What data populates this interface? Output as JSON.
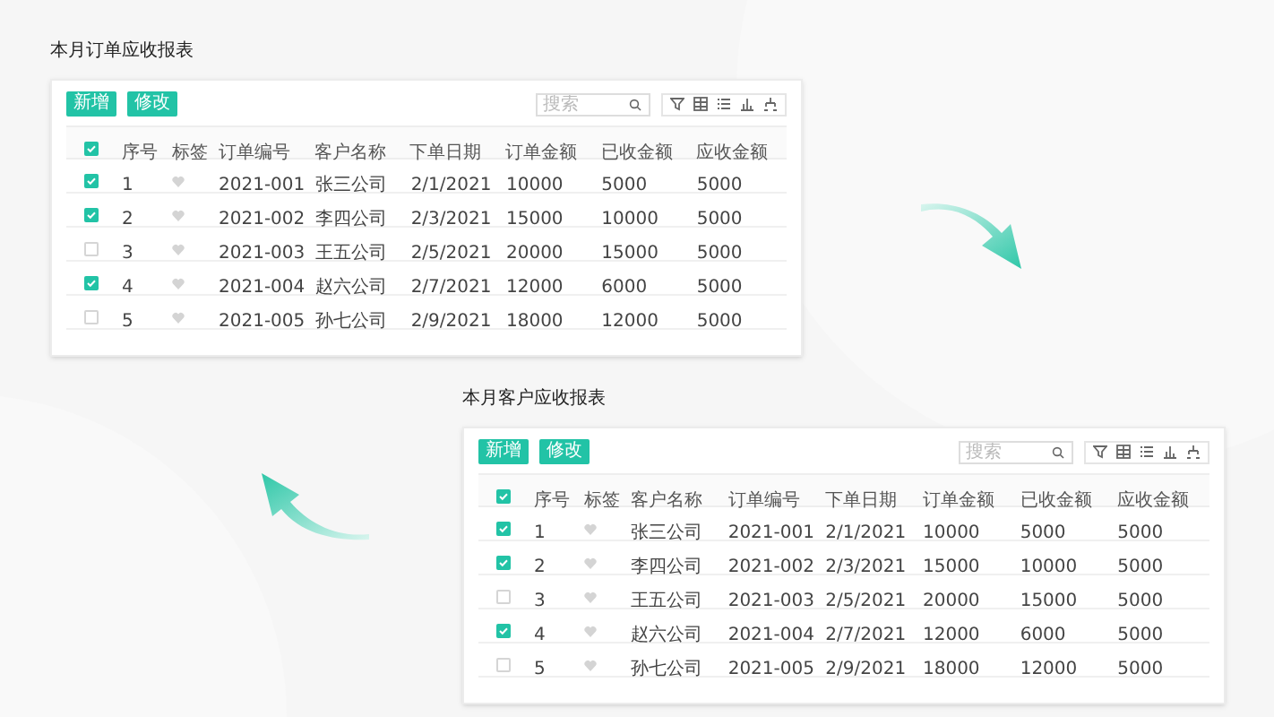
{
  "reports": [
    {
      "title": "本月订单应收报表",
      "buttons": [
        "新增",
        "修改"
      ],
      "search": {
        "placeholder": "搜索"
      },
      "table": {
        "header_checked": true,
        "columns": [
          "序号",
          "标签",
          "订单编号",
          "客户名称",
          "下单日期",
          "订单金额",
          "已收金额",
          "应收金额"
        ],
        "rows": [
          {
            "checked": true,
            "cells": [
              "1",
              "",
              "2021-001",
              "张三公司",
              "2/1/2021",
              "10000",
              "5000",
              "5000"
            ]
          },
          {
            "checked": true,
            "cells": [
              "2",
              "",
              "2021-002",
              "李四公司",
              "2/3/2021",
              "15000",
              "10000",
              "5000"
            ]
          },
          {
            "checked": false,
            "cells": [
              "3",
              "",
              "2021-003",
              "王五公司",
              "2/5/2021",
              "20000",
              "15000",
              "5000"
            ]
          },
          {
            "checked": true,
            "cells": [
              "4",
              "",
              "2021-004",
              "赵六公司",
              "2/7/2021",
              "12000",
              "6000",
              "5000"
            ]
          },
          {
            "checked": false,
            "cells": [
              "5",
              "",
              "2021-005",
              "孙七公司",
              "2/9/2021",
              "18000",
              "12000",
              "5000"
            ]
          }
        ]
      }
    },
    {
      "title": "本月客户应收报表",
      "buttons": [
        "新增",
        "修改"
      ],
      "search": {
        "placeholder": "搜索"
      },
      "table": {
        "header_checked": true,
        "columns": [
          "序号",
          "标签",
          "客户名称",
          "订单编号",
          "下单日期",
          "订单金额",
          "已收金额",
          "应收金额"
        ],
        "rows": [
          {
            "checked": true,
            "cells": [
              "1",
              "",
              "张三公司",
              "2021-001",
              "2/1/2021",
              "10000",
              "5000",
              "5000"
            ]
          },
          {
            "checked": true,
            "cells": [
              "2",
              "",
              "李四公司",
              "2021-002",
              "2/3/2021",
              "15000",
              "10000",
              "5000"
            ]
          },
          {
            "checked": false,
            "cells": [
              "3",
              "",
              "王五公司",
              "2021-003",
              "2/5/2021",
              "20000",
              "15000",
              "5000"
            ]
          },
          {
            "checked": true,
            "cells": [
              "4",
              "",
              "赵六公司",
              "2021-004",
              "2/7/2021",
              "12000",
              "6000",
              "5000"
            ]
          },
          {
            "checked": false,
            "cells": [
              "5",
              "",
              "孙七公司",
              "2021-005",
              "2/9/2021",
              "18000",
              "12000",
              "5000"
            ]
          }
        ]
      }
    }
  ]
}
